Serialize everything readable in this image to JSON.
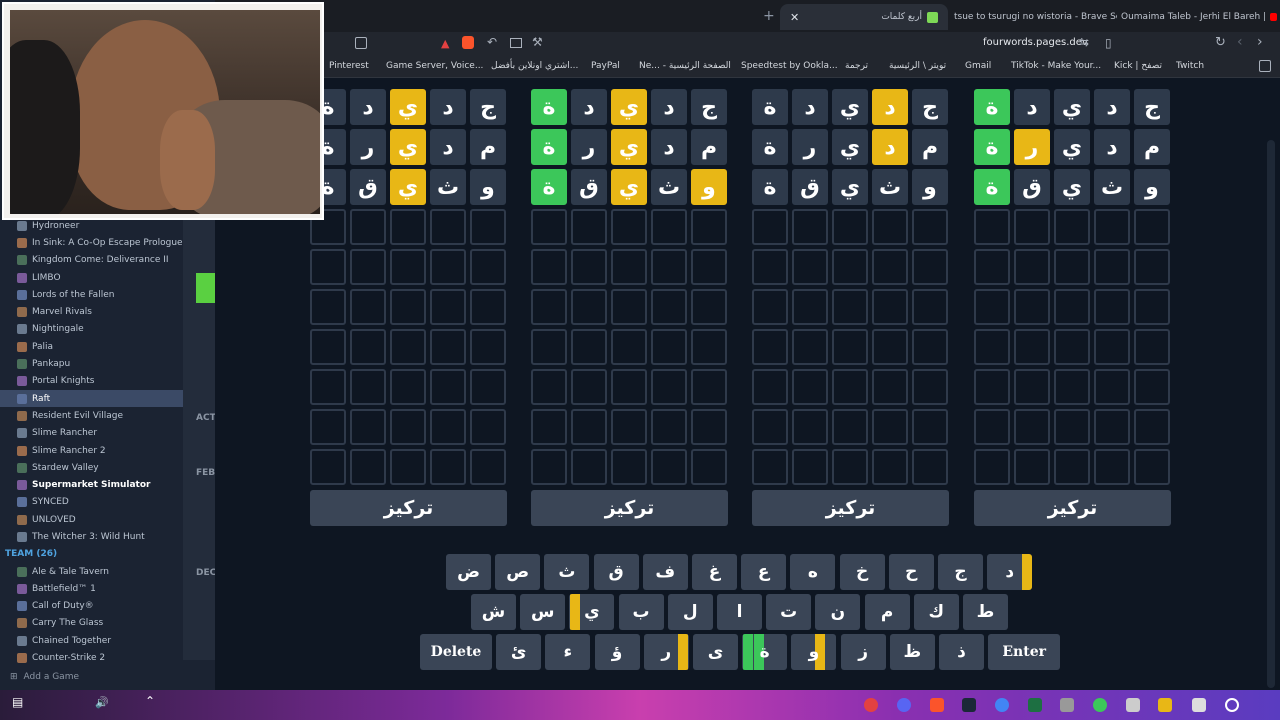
{
  "browser": {
    "tabs": [
      {
        "label": "أربع كلمات",
        "active": true
      },
      {
        "label": "tsue to tsurugi no wistoria - Brave Se",
        "active": false
      },
      {
        "label": "Oumaima Taleb - Jerhi El Bareh |",
        "active": false
      }
    ],
    "url": "fourwords.pages.dev",
    "bookmarks": [
      "Pinterest",
      "Game Server, Voice...",
      "اشتري اونلاين بأفضل...",
      "PayPal",
      "Ne... - الصفحة الرئيسية",
      "Speedtest by Ookla...",
      "ترجمة",
      "تويتر \\ الرئيسية",
      "Gmail",
      "TikTok - Make Your...",
      "Kick | تصفح",
      "Twitch"
    ]
  },
  "steam": {
    "games": [
      {
        "label": "Hydroneer",
        "style": ""
      },
      {
        "label": "In Sink: A Co-Op Escape Prologue",
        "style": ""
      },
      {
        "label": "Kingdom Come: Deliverance II",
        "style": ""
      },
      {
        "label": "LIMBO",
        "style": ""
      },
      {
        "label": "Lords of the Fallen",
        "style": ""
      },
      {
        "label": "Marvel Rivals",
        "style": ""
      },
      {
        "label": "Nightingale",
        "style": ""
      },
      {
        "label": "Palia",
        "style": ""
      },
      {
        "label": "Pankapu",
        "style": ""
      },
      {
        "label": "Portal Knights",
        "style": ""
      },
      {
        "label": "Raft",
        "style": "sel"
      },
      {
        "label": "Resident Evil Village",
        "style": ""
      },
      {
        "label": "Slime Rancher",
        "style": ""
      },
      {
        "label": "Slime Rancher 2",
        "style": ""
      },
      {
        "label": "Stardew Valley",
        "style": ""
      },
      {
        "label": "Supermarket Simulator",
        "style": "bold"
      },
      {
        "label": "SYNCED",
        "style": ""
      },
      {
        "label": "UNLOVED",
        "style": ""
      },
      {
        "label": "The Witcher 3: Wild Hunt",
        "style": ""
      },
      {
        "label": "TEAM (26)",
        "style": "team"
      },
      {
        "label": "Ale & Tale Tavern",
        "style": ""
      },
      {
        "label": "Battlefield™ 1",
        "style": ""
      },
      {
        "label": "Call of Duty®",
        "style": ""
      },
      {
        "label": "Carry The Glass",
        "style": ""
      },
      {
        "label": "Chained Together",
        "style": ""
      },
      {
        "label": "Counter-Strike 2",
        "style": ""
      }
    ],
    "add_game": "Add a Game",
    "mid_labels": [
      "ACT",
      "FEB",
      "DEC"
    ]
  },
  "game": {
    "focus_label": "تركيز",
    "boards": [
      {
        "rows": [
          [
            [
              "ج",
              ""
            ],
            [
              "د",
              ""
            ],
            [
              "ي",
              "yellow"
            ],
            [
              "د",
              ""
            ],
            [
              "ة",
              ""
            ]
          ],
          [
            [
              "م",
              ""
            ],
            [
              "د",
              ""
            ],
            [
              "ي",
              "yellow"
            ],
            [
              "ر",
              ""
            ],
            [
              "ة",
              ""
            ]
          ],
          [
            [
              "و",
              ""
            ],
            [
              "ث",
              ""
            ],
            [
              "ي",
              "yellow"
            ],
            [
              "ق",
              ""
            ],
            [
              "ة",
              ""
            ]
          ]
        ]
      },
      {
        "rows": [
          [
            [
              "ج",
              ""
            ],
            [
              "د",
              ""
            ],
            [
              "ي",
              "yellow"
            ],
            [
              "د",
              ""
            ],
            [
              "ة",
              "green"
            ]
          ],
          [
            [
              "م",
              ""
            ],
            [
              "د",
              ""
            ],
            [
              "ي",
              "yellow"
            ],
            [
              "ر",
              ""
            ],
            [
              "ة",
              "green"
            ]
          ],
          [
            [
              "و",
              "yellow"
            ],
            [
              "ث",
              ""
            ],
            [
              "ي",
              "yellow"
            ],
            [
              "ق",
              ""
            ],
            [
              "ة",
              "green"
            ]
          ]
        ]
      },
      {
        "rows": [
          [
            [
              "ج",
              ""
            ],
            [
              "د",
              "yellow"
            ],
            [
              "ي",
              ""
            ],
            [
              "د",
              ""
            ],
            [
              "ة",
              ""
            ]
          ],
          [
            [
              "م",
              ""
            ],
            [
              "د",
              "yellow"
            ],
            [
              "ي",
              ""
            ],
            [
              "ر",
              ""
            ],
            [
              "ة",
              ""
            ]
          ],
          [
            [
              "و",
              ""
            ],
            [
              "ث",
              ""
            ],
            [
              "ي",
              ""
            ],
            [
              "ق",
              ""
            ],
            [
              "ة",
              ""
            ]
          ]
        ]
      },
      {
        "rows": [
          [
            [
              "ج",
              ""
            ],
            [
              "د",
              ""
            ],
            [
              "ي",
              ""
            ],
            [
              "د",
              ""
            ],
            [
              "ة",
              "green"
            ]
          ],
          [
            [
              "م",
              ""
            ],
            [
              "د",
              ""
            ],
            [
              "ي",
              ""
            ],
            [
              "ر",
              "yellow"
            ],
            [
              "ة",
              "green"
            ]
          ],
          [
            [
              "و",
              ""
            ],
            [
              "ث",
              ""
            ],
            [
              "ي",
              ""
            ],
            [
              "ق",
              ""
            ],
            [
              "ة",
              "green"
            ]
          ]
        ]
      }
    ],
    "keyboard": {
      "row1": [
        [
          "ض",
          ""
        ],
        [
          "ص",
          ""
        ],
        [
          "ث",
          ""
        ],
        [
          "ق",
          ""
        ],
        [
          "ف",
          ""
        ],
        [
          "غ",
          ""
        ],
        [
          "ع",
          ""
        ],
        [
          "ه",
          ""
        ],
        [
          "خ",
          ""
        ],
        [
          "ح",
          ""
        ],
        [
          "ج",
          ""
        ],
        [
          "د",
          "y4"
        ]
      ],
      "row2": [
        [
          "ش",
          ""
        ],
        [
          "س",
          ""
        ],
        [
          "ي",
          "y1"
        ],
        [
          "ب",
          ""
        ],
        [
          "ل",
          ""
        ],
        [
          "ا",
          ""
        ],
        [
          "ت",
          ""
        ],
        [
          "ن",
          ""
        ],
        [
          "م",
          ""
        ],
        [
          "ك",
          ""
        ],
        [
          "ط",
          ""
        ]
      ],
      "row3": [
        [
          "Delete",
          "wide"
        ],
        [
          "ئ",
          ""
        ],
        [
          "ء",
          ""
        ],
        [
          "ؤ",
          ""
        ],
        [
          "ر",
          "y4"
        ],
        [
          "ى",
          ""
        ],
        [
          "ة",
          "g12"
        ],
        [
          "و",
          "y3"
        ],
        [
          "ز",
          ""
        ],
        [
          "ظ",
          ""
        ],
        [
          "ذ",
          ""
        ],
        [
          "Enter",
          "wide"
        ]
      ]
    }
  }
}
